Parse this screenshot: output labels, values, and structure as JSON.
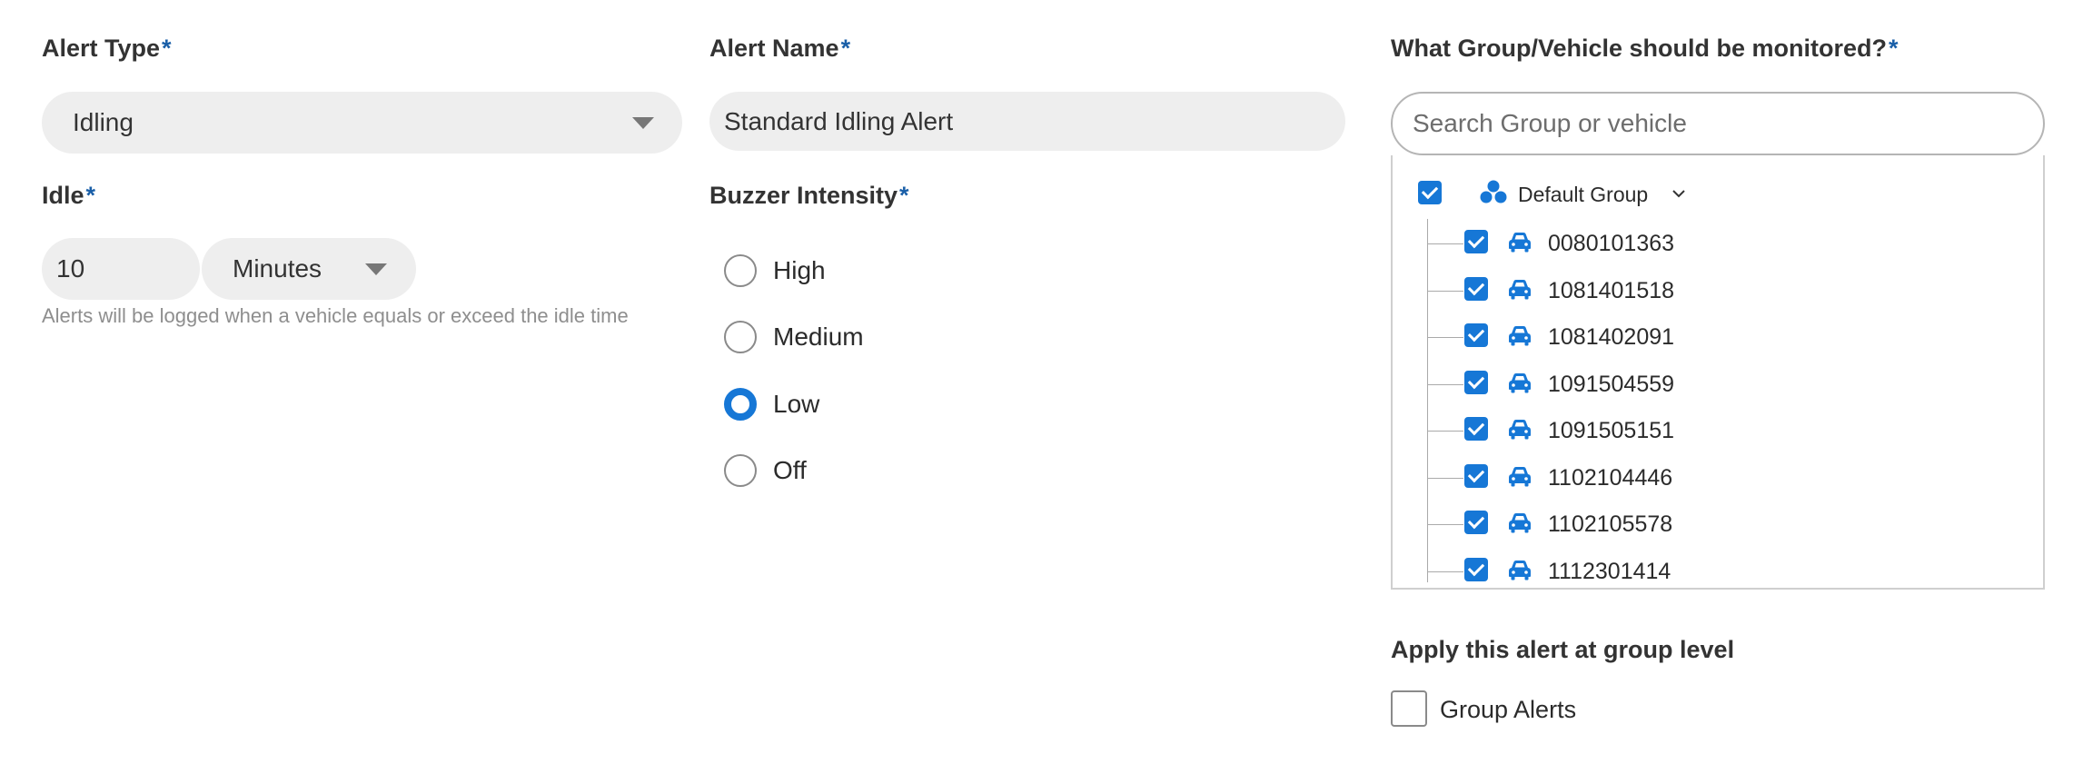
{
  "alert_type": {
    "label": "Alert Type",
    "required_marker": "*",
    "selected": "Idling"
  },
  "alert_name": {
    "label": "Alert Name",
    "required_marker": "*",
    "value": "Standard Idling Alert"
  },
  "idle": {
    "label": "Idle",
    "required_marker": "*",
    "value": "10",
    "unit_selected": "Minutes",
    "hint": "Alerts will be logged when a vehicle equals or exceed the idle time"
  },
  "buzzer": {
    "label": "Buzzer Intensity",
    "required_marker": "*",
    "options": [
      {
        "label": "High",
        "checked": false
      },
      {
        "label": "Medium",
        "checked": false
      },
      {
        "label": "Low",
        "checked": true
      },
      {
        "label": "Off",
        "checked": false
      }
    ]
  },
  "monitor": {
    "label": "What Group/Vehicle should be monitored?",
    "required_marker": "*",
    "search_placeholder": "Search Group or vehicle",
    "group": {
      "label": "Default Group",
      "checked": true
    },
    "vehicles": [
      {
        "id": "0080101363",
        "checked": true
      },
      {
        "id": "1081401518",
        "checked": true
      },
      {
        "id": "1081402091",
        "checked": true
      },
      {
        "id": "1091504559",
        "checked": true
      },
      {
        "id": "1091505151",
        "checked": true
      },
      {
        "id": "1102104446",
        "checked": true
      },
      {
        "id": "1102105578",
        "checked": true
      },
      {
        "id": "1112301414",
        "checked": true
      }
    ]
  },
  "group_level": {
    "label": "Apply this alert at group level",
    "checkbox_label": "Group Alerts",
    "checked": false
  },
  "colors": {
    "accent": "#1677d6",
    "required": "#1a5fa8",
    "field_bg": "#eeeeee"
  },
  "icons": {
    "group": "group-icon",
    "vehicle": "car-icon",
    "dropdown": "caret-down-icon",
    "expand": "chevron-down-icon"
  }
}
